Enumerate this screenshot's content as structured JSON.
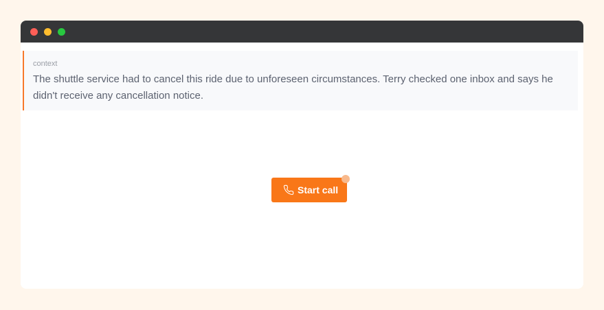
{
  "window": {
    "controls": [
      "close",
      "minimize",
      "maximize"
    ]
  },
  "context": {
    "label": "context",
    "text": "The shuttle service had to cancel this ride due to unforeseen circumstances. Terry checked one inbox and says he didn't receive any cancellation notice."
  },
  "call_button": {
    "label": "Start call",
    "icon": "phone-icon"
  },
  "colors": {
    "accent": "#f97718",
    "background": "#fff6ec",
    "titlebar": "#353638",
    "notification_dot": "#f8b98c"
  }
}
